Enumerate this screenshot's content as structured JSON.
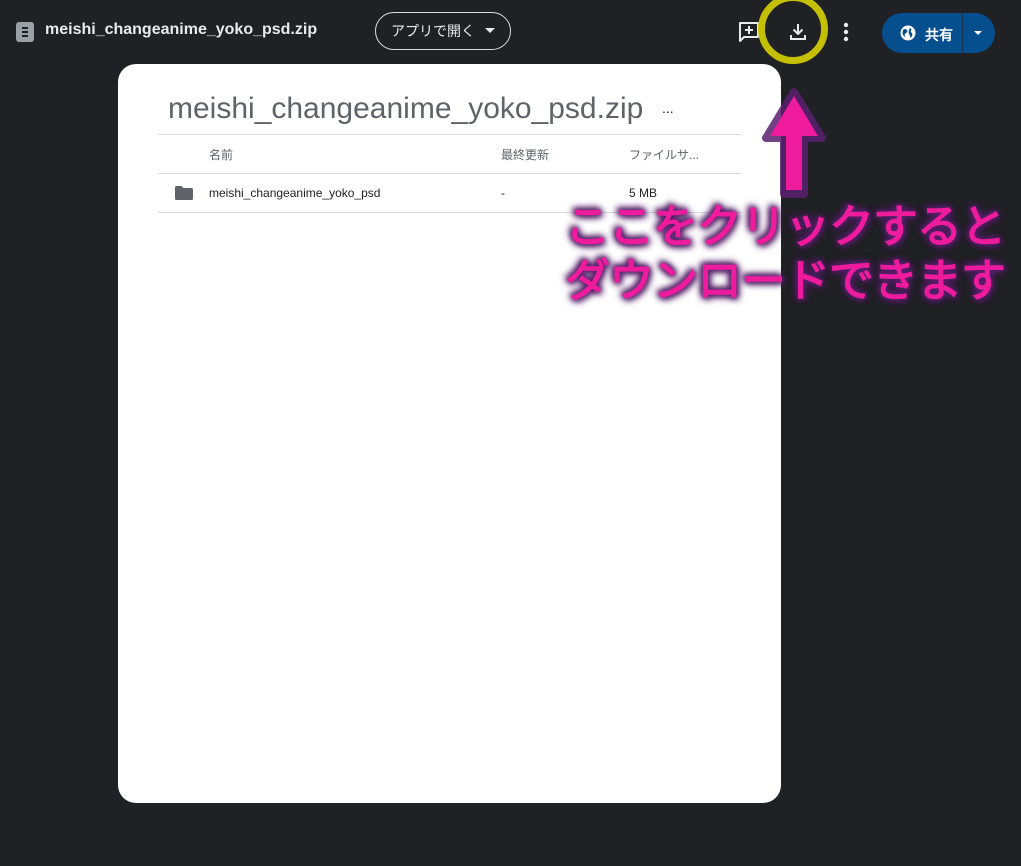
{
  "header": {
    "file_title": "meishi_changeanime_yoko_psd.zip",
    "open_with_label": "アプリで開く",
    "share_label": "共有"
  },
  "preview": {
    "title": "meishi_changeanime_yoko_psd.zip",
    "more_label": "...",
    "columns": {
      "name": "名前",
      "modified": "最終更新",
      "size": "ファイルサ..."
    },
    "rows": [
      {
        "name": "meishi_changeanime_yoko_psd",
        "modified": "-",
        "size": "5 MB"
      }
    ]
  },
  "annotation": {
    "line1": "ここをクリックすると",
    "line2": "ダウンロードできます"
  },
  "icons": {
    "file": "file-icon",
    "add_comment": "add-comment-icon",
    "download": "download-icon",
    "more": "more-vert-icon",
    "globe": "globe-icon",
    "folder": "folder-icon"
  },
  "colors": {
    "background": "#202124",
    "share_button": "#064f8f",
    "highlight_ring": "#c4c000",
    "annotation_text": "#ee1c9d"
  }
}
